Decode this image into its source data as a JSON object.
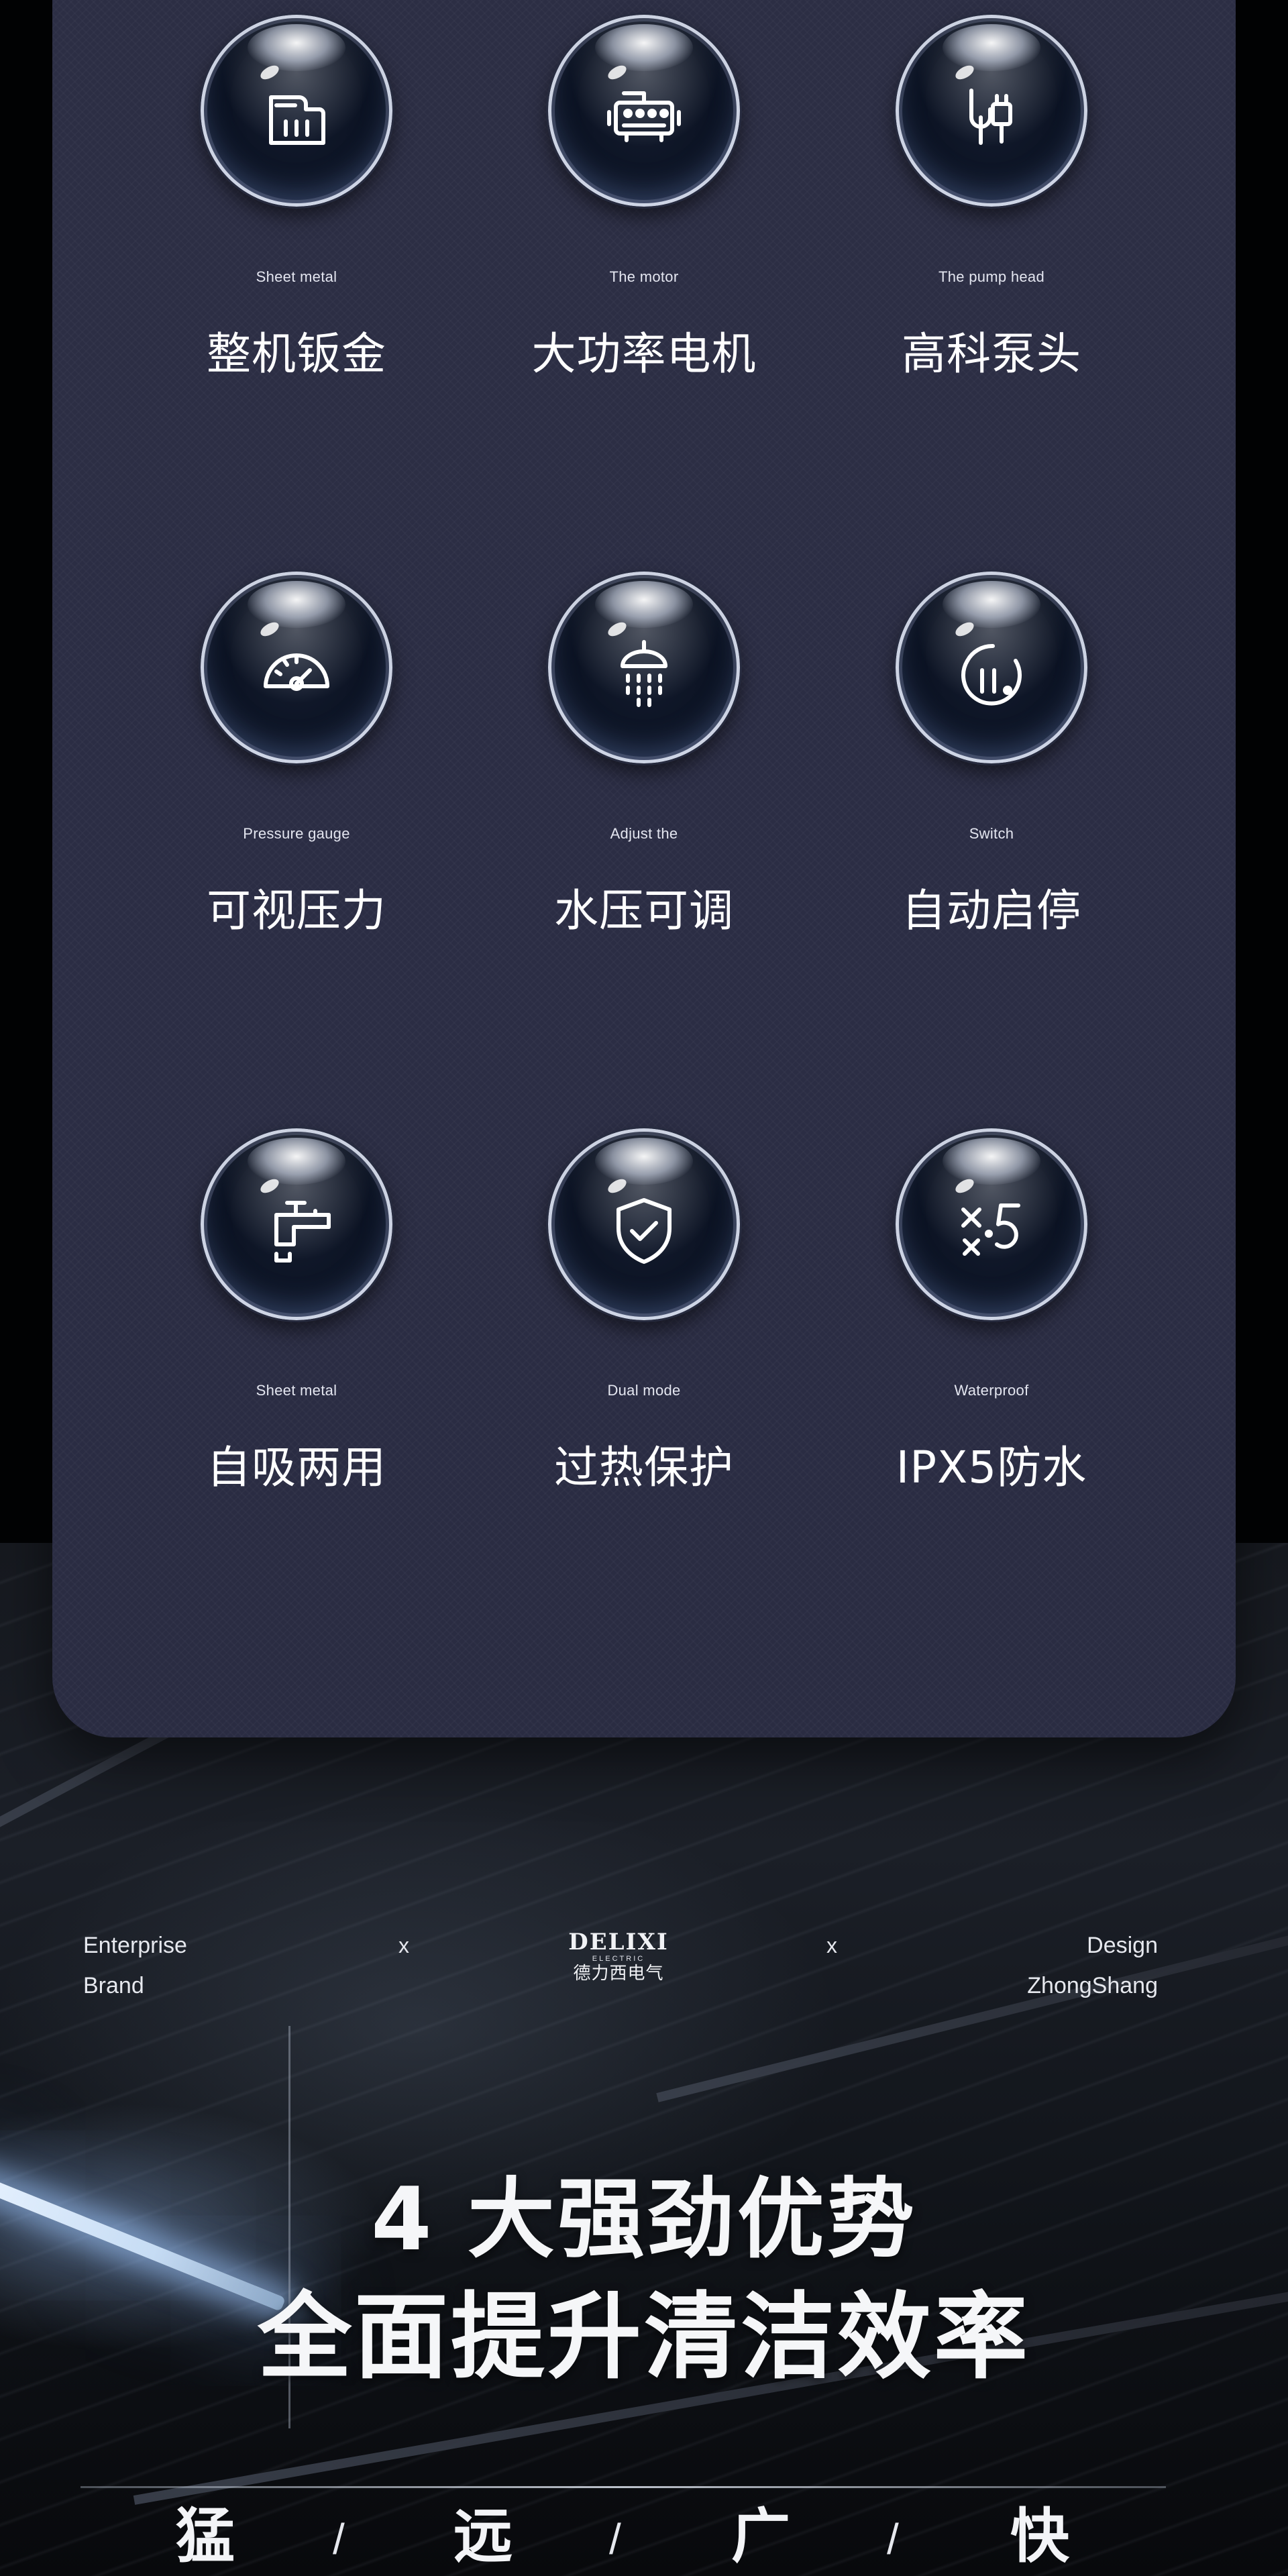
{
  "features": [
    {
      "icon": "sheet-metal-icon",
      "en": "Sheet metal",
      "cn": "整机钣金"
    },
    {
      "icon": "motor-icon",
      "en": "The motor",
      "cn": "大功率电机"
    },
    {
      "icon": "pump-head-icon",
      "en": "The pump head",
      "cn": "高科泵头"
    },
    {
      "icon": "pressure-gauge-icon",
      "en": "Pressure gauge",
      "cn": "可视压力"
    },
    {
      "icon": "shower-icon",
      "en": "Adjust the",
      "cn": "水压可调"
    },
    {
      "icon": "switch-icon",
      "en": "Switch",
      "cn": "自动启停"
    },
    {
      "icon": "faucet-icon",
      "en": "Sheet metal",
      "cn": "自吸两用"
    },
    {
      "icon": "shield-check-icon",
      "en": "Dual mode",
      "cn": "过热保护"
    },
    {
      "icon": "ipx5-icon",
      "en": "Waterproof",
      "cn": "IPX5防水"
    }
  ],
  "brand": {
    "left_line1": "Enterprise",
    "left_line2": "Brand",
    "separator": "x",
    "logo_main": "DELIXI",
    "logo_sub": "ELECTRIC",
    "logo_cn": "德力西电气",
    "right_line1": "Design",
    "right_line2": "ZhongShang"
  },
  "headline": {
    "line1": "4 大强劲优势",
    "line2": "全面提升清洁效率"
  },
  "bottom": {
    "words": [
      "猛",
      "远",
      "广",
      "快"
    ],
    "separator": "/"
  },
  "colors": {
    "card_bg": "#2c2e44",
    "text": "#ffffff",
    "orb_core": "#0b1222"
  }
}
